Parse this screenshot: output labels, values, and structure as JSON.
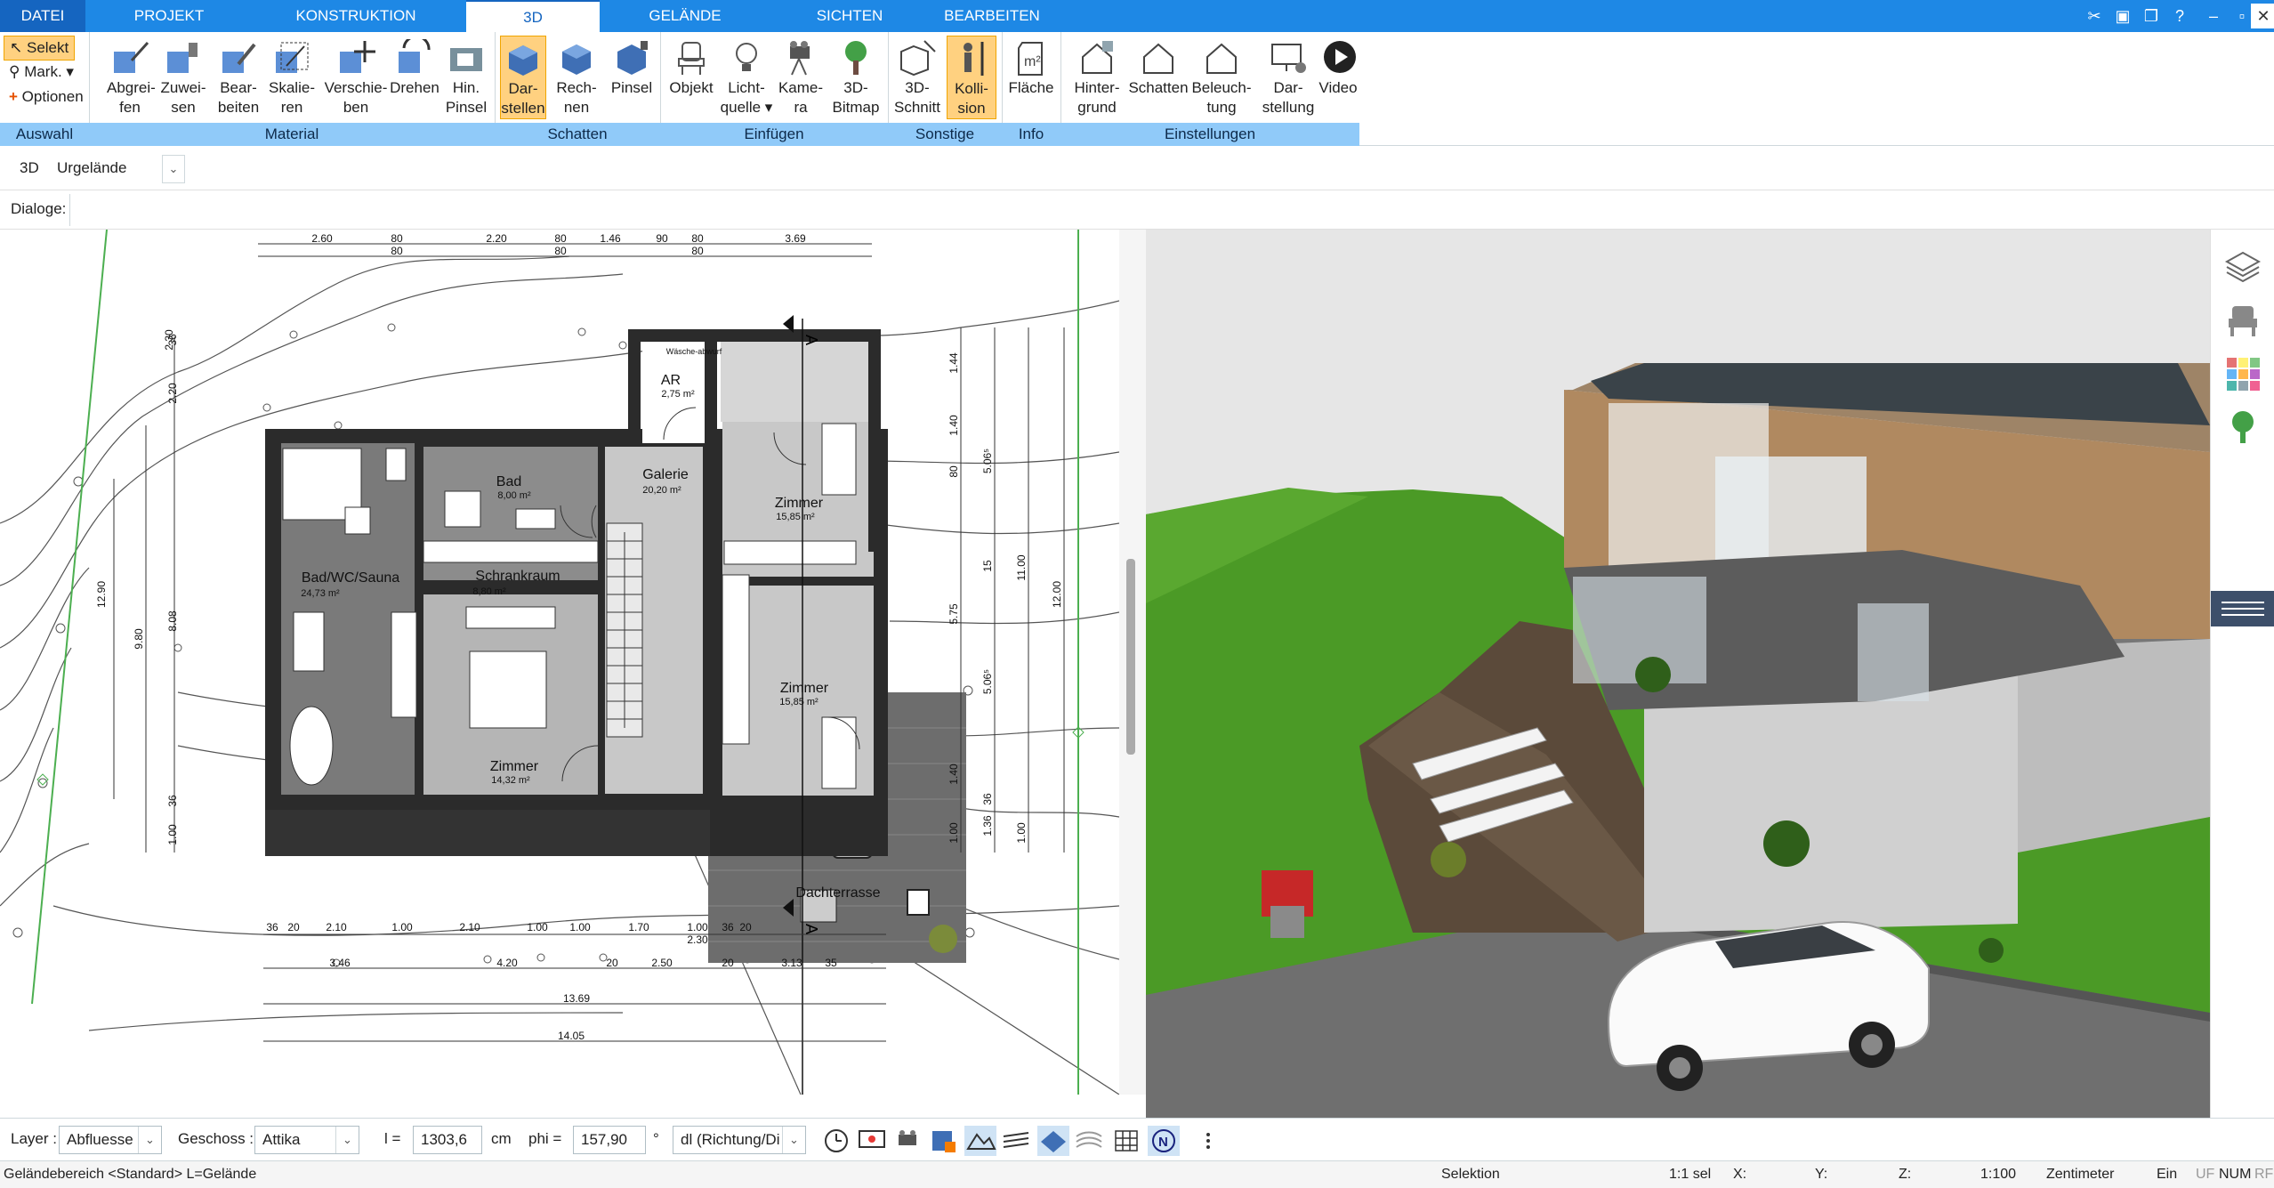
{
  "tabs": [
    "DATEI",
    "PROJEKT",
    "KONSTRUKTION",
    "3D",
    "GELÄNDE",
    "SICHTEN",
    "BEARBEITEN"
  ],
  "selection": {
    "selekt": "Selekt",
    "mark": "Mark.",
    "optionen": "Optionen",
    "group": "Auswahl"
  },
  "material": {
    "group": "Material",
    "buttons": [
      {
        "l1": "Abgrei-",
        "l2": "fen"
      },
      {
        "l1": "Zuwei-",
        "l2": "sen"
      },
      {
        "l1": "Bear-",
        "l2": "beiten"
      },
      {
        "l1": "Skalie-",
        "l2": "ren"
      },
      {
        "l1": "Verschie-",
        "l2": "ben"
      },
      {
        "l1": "Drehen",
        "l2": ""
      },
      {
        "l1": "Hin.",
        "l2": "Pinsel"
      }
    ]
  },
  "schatten": {
    "group": "Schatten",
    "buttons": [
      {
        "l1": "Dar-",
        "l2": "stellen"
      },
      {
        "l1": "Rech-",
        "l2": "nen"
      },
      {
        "l1": "Pinsel",
        "l2": ""
      }
    ]
  },
  "einfuegen": {
    "group": "Einfügen",
    "buttons": [
      {
        "l1": "Objekt",
        "l2": ""
      },
      {
        "l1": "Licht-",
        "l2": "quelle"
      },
      {
        "l1": "Kame-",
        "l2": "ra"
      },
      {
        "l1": "3D-",
        "l2": "Bitmap"
      }
    ]
  },
  "sonstige": {
    "group": "Sonstige",
    "buttons": [
      {
        "l1": "3D-",
        "l2": "Schnitt"
      },
      {
        "l1": "Kolli-",
        "l2": "sion"
      }
    ]
  },
  "info": {
    "group": "Info",
    "buttons": [
      {
        "l1": "Fläche",
        "l2": ""
      }
    ]
  },
  "einstellungen": {
    "group": "Einstellungen",
    "buttons": [
      {
        "l1": "Hinter-",
        "l2": "grund"
      },
      {
        "l1": "Schatten",
        "l2": ""
      },
      {
        "l1": "Beleuch-",
        "l2": "tung"
      },
      {
        "l1": "Dar-",
        "l2": "stellung"
      },
      {
        "l1": "Video",
        "l2": ""
      }
    ]
  },
  "viewbar": {
    "mode": "3D",
    "terrain": "Urgelände"
  },
  "dialoge": "Dialoge:",
  "plan": {
    "rooms": [
      {
        "name": "Bad/WC/Sauna",
        "area": "24,73 m²"
      },
      {
        "name": "Bad",
        "area": "8,00 m²"
      },
      {
        "name": "Schrankraum",
        "area": "8,80 m²"
      },
      {
        "name": "Galerie",
        "area": "20,20 m²"
      },
      {
        "name": "Zimmer",
        "area": "15,85 m²"
      },
      {
        "name": "Zimmer",
        "area": "15,85 m²"
      },
      {
        "name": "Zimmer",
        "area": "14,32 m²"
      },
      {
        "name": "AR",
        "area": "2,75 m²"
      },
      {
        "name": "Dachterrasse",
        "area": ""
      }
    ],
    "top_dims": [
      "2.60",
      "80",
      "2.20",
      "80",
      "1.46",
      "90",
      "80",
      "3.69"
    ],
    "top_dims2": [
      "80",
      "80",
      "80"
    ],
    "bottom_dims1": [
      "36",
      "20",
      "2.10",
      "1.00",
      "2.10",
      "1.00",
      "1.00",
      "1.70",
      "1.00",
      "36",
      "20"
    ],
    "bottom_dims2": [
      "3.46",
      "4.20",
      "20",
      "2.50",
      "20",
      "3.13",
      "35"
    ],
    "total_1": "13.69",
    "total_2": "14.05",
    "mid": "2.30",
    "left_dims": [
      "2.30",
      "2.20",
      "12.90",
      "9.80",
      "8.08",
      "36",
      "1.00",
      "36"
    ],
    "right_dims": [
      "1.44",
      "1.40",
      "80",
      "5.06⁵",
      "15",
      "5.75",
      "5.06⁵",
      "1.40",
      "1.00",
      "36",
      "1.36",
      "11.00",
      "12.00",
      "1.00"
    ],
    "section": "A",
    "waesche": "Wäsche-abwurf"
  },
  "bottom": {
    "layer_label": "Layer :",
    "layer_value": "Abfluesse",
    "geschoss_label": "Geschoss :",
    "geschoss_value": "Attika",
    "l_label": "l =",
    "l_value": "1303,6",
    "unit": "cm",
    "phi_label": "phi =",
    "phi_value": "157,90",
    "deg": "°",
    "dl_value": "dl (Richtung/Di"
  },
  "status": {
    "left": "Geländebereich <Standard> L=Gelände",
    "mode": "Selektion",
    "scale_sel": "1:1 sel",
    "x": "X:",
    "y": "Y:",
    "z": "Z:",
    "scale": "1:100",
    "unit": "Zentimeter",
    "ein": "Ein",
    "uf": "UF",
    "num": "NUM",
    "rf": "RF"
  }
}
